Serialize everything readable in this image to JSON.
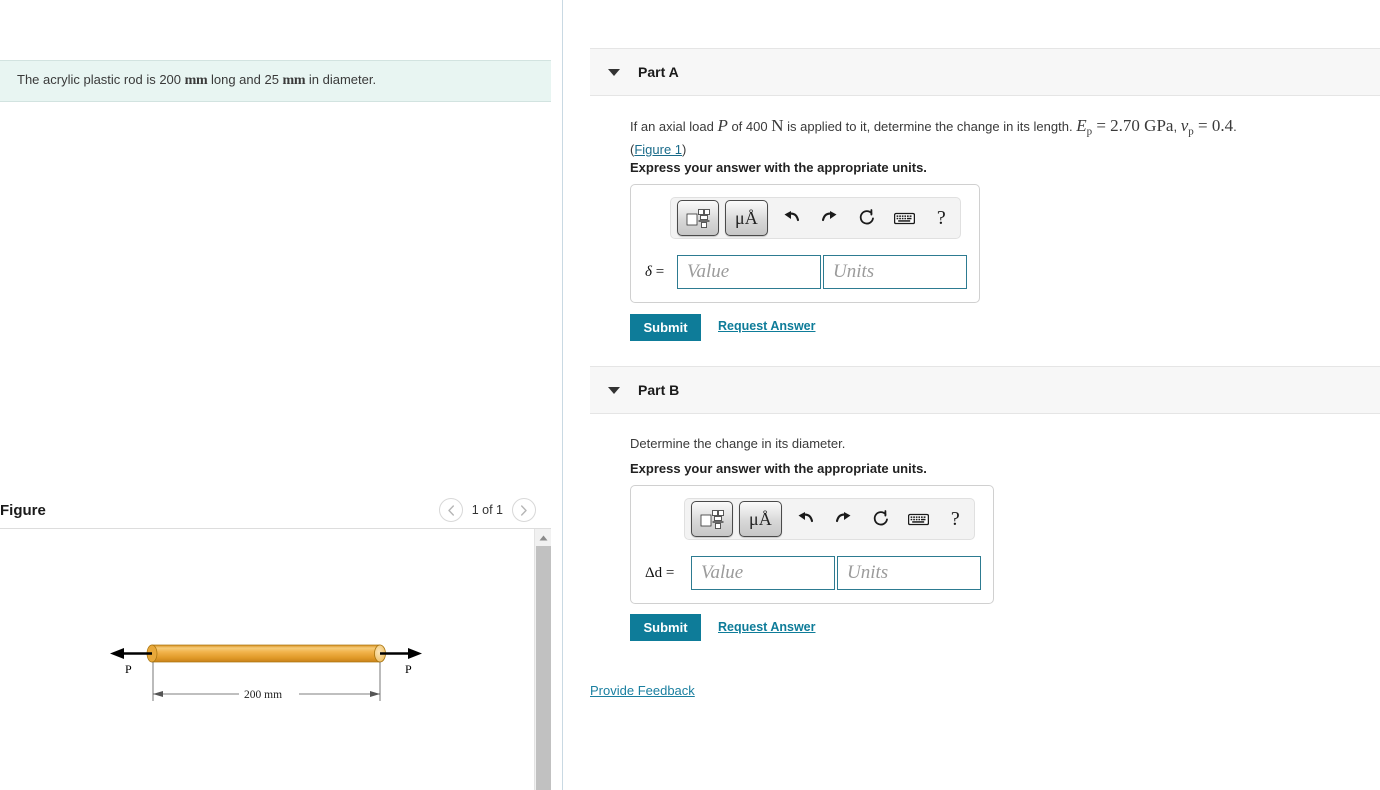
{
  "problem": {
    "text_part1": "The acrylic plastic rod is 200 ",
    "unit1": "mm",
    "text_part2": " long and 25 ",
    "unit2": "mm",
    "text_part3": " in diameter."
  },
  "figure": {
    "title": "Figure",
    "counter": "1 of 1",
    "prev_icon": "chevron-left-icon",
    "next_icon": "chevron-right-icon",
    "diagram": {
      "left_force_label": "P",
      "right_force_label": "P",
      "dimension_label": "200 mm",
      "rod_color": "#e8a33d"
    }
  },
  "parts": [
    {
      "id": "A",
      "title": "Part A",
      "question_pre": "If an axial load ",
      "question_var": "P",
      "question_mid": " of 400 ",
      "question_unit": "N",
      "question_post": " is applied to it, determine the change in its length. ",
      "given_1": "E",
      "given_1_sub": "p",
      "given_1_val": " = 2.70 GPa",
      "given_sep": ", ",
      "given_2": "ν",
      "given_2_sub": "p",
      "given_2_val": " = 0.4",
      "question_end": ".",
      "figure_link": "Figure 1",
      "instruction": "Express your answer with the appropriate units.",
      "answer_symbol": "δ",
      "answer_equals": "=",
      "value_placeholder": "Value",
      "units_placeholder": "Units",
      "submit_label": "Submit",
      "request_label": "Request Answer"
    },
    {
      "id": "B",
      "title": "Part B",
      "question": "Determine the change in its diameter.",
      "instruction": "Express your answer with the appropriate units.",
      "answer_symbol": "Δd",
      "answer_equals": "=",
      "value_placeholder": "Value",
      "units_placeholder": "Units",
      "submit_label": "Submit",
      "request_label": "Request Answer"
    }
  ],
  "toolbar": {
    "template_icon": "math-template-icon",
    "units_label": "μÅ",
    "undo_icon": "undo-arrow-icon",
    "redo_icon": "redo-arrow-icon",
    "reset_icon": "reset-circle-icon",
    "keyboard_icon": "keyboard-icon",
    "help_label": "?"
  },
  "footer": {
    "feedback_label": "Provide Feedback"
  },
  "colors": {
    "accent": "#0e7c99",
    "statement_bg": "#e8f5f2",
    "field_border": "#2d7b91"
  }
}
